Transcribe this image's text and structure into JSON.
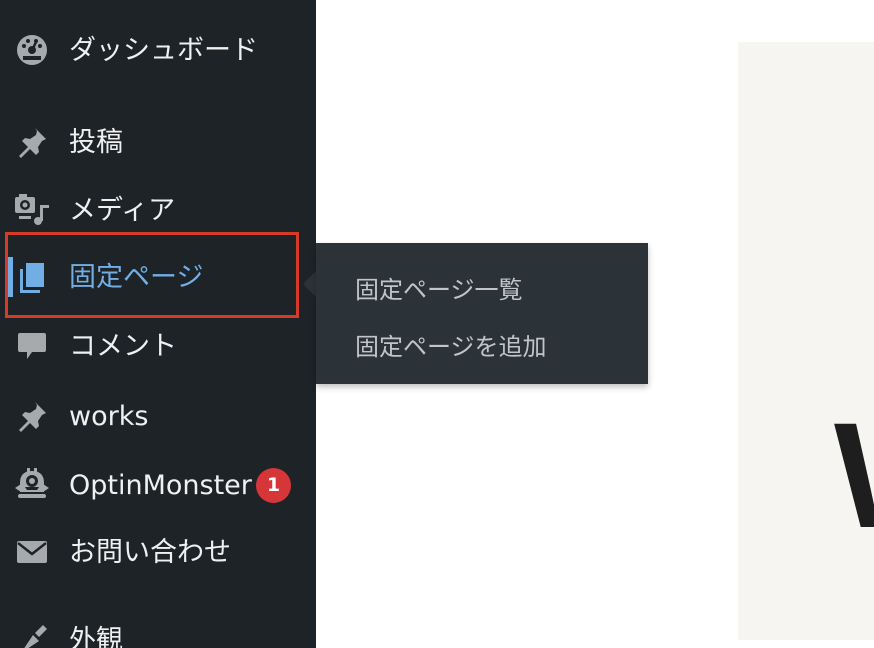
{
  "sidebar": {
    "items": [
      {
        "label": "ダッシュボード",
        "icon": "dashboard-icon"
      },
      {
        "label": "投稿",
        "icon": "pin-icon"
      },
      {
        "label": "メディア",
        "icon": "media-icon"
      },
      {
        "label": "固定ページ",
        "icon": "pages-icon"
      },
      {
        "label": "コメント",
        "icon": "comment-icon"
      },
      {
        "label": "works",
        "icon": "pin-icon"
      },
      {
        "label": "OptinMonster",
        "icon": "monster-icon",
        "badge": "1"
      },
      {
        "label": "お問い合わせ",
        "icon": "mail-icon"
      },
      {
        "label": "外観",
        "icon": "brush-icon"
      }
    ]
  },
  "flyout": {
    "items": [
      {
        "label": "固定ページ一覧"
      },
      {
        "label": "固定ページを追加"
      }
    ]
  },
  "content": {
    "heading_fragment": "W"
  },
  "colors": {
    "sidebar_bg": "#1d2327",
    "flyout_bg": "#2c3338",
    "active_text": "#72aee6",
    "badge": "#d63638",
    "highlight": "#d63b26"
  }
}
